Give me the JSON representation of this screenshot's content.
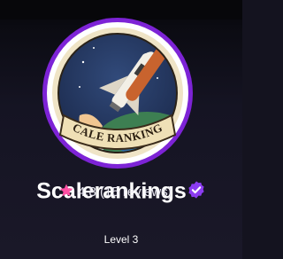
{
  "profile": {
    "name": "Scalerankings",
    "verified": true,
    "rating": "4.8",
    "reviews": "(15 reviews)",
    "level": "Level 3",
    "avatar_badge_text": "SCALE RANKINGS"
  },
  "colors": {
    "accent": "#8a2be2",
    "star": "#ff4fa3",
    "verified": "#8b3cf0"
  },
  "icons": {
    "verified": "verified-badge-icon",
    "rating": "star-icon"
  }
}
